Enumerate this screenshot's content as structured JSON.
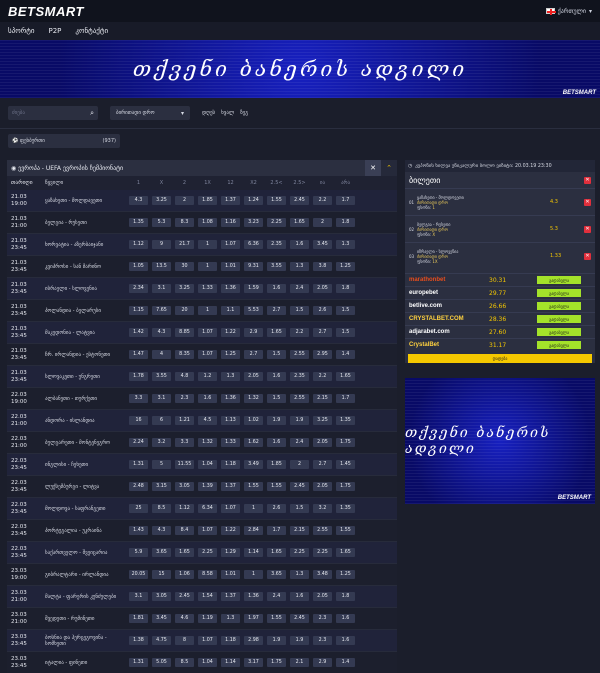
{
  "header": {
    "logo": "BETSMART",
    "language": "ქართული"
  },
  "nav": [
    "სპორტი",
    "P2P",
    "კონტაქტი"
  ],
  "banner": {
    "text": "თქვენი ბანერის ადგილი",
    "logo": "BETSMART"
  },
  "filters": {
    "search_placeholder": "ძიება",
    "period_select": "ბირითადი დრო",
    "periods": [
      "დღეს",
      "ხვალ",
      "ზეგ"
    ]
  },
  "sport_tab": {
    "label": "ფეხბურთი",
    "count": "(937)"
  },
  "league": {
    "name": "ევროპა - UEFA ევროპის ჩემპიონატი"
  },
  "columns": [
    "თარიღი",
    "წყვილი",
    "1",
    "X",
    "2",
    "1X",
    "12",
    "X2",
    "2.5<",
    "2.5>",
    "ია",
    "არა"
  ],
  "matches": [
    {
      "time": [
        "21.03",
        "19:00"
      ],
      "teams": "ყაზახეთი - მოლდავეთი",
      "odds": [
        "4.3",
        "3.25",
        "2",
        "1.85",
        "1.37",
        "1.24",
        "1.55",
        "2.45",
        "2.2",
        "1.7"
      ]
    },
    {
      "time": [
        "21.03",
        "21:00"
      ],
      "teams": "ბელგია - რუსეთი",
      "odds": [
        "1.35",
        "5.3",
        "8.3",
        "1.08",
        "1.16",
        "3.23",
        "2.25",
        "1.65",
        "2",
        "1.8"
      ]
    },
    {
      "time": [
        "21.03",
        "23:45"
      ],
      "teams": "ხორვატია - აზერბაიჯანი",
      "odds": [
        "1.12",
        "9",
        "21.7",
        "1",
        "1.07",
        "6.36",
        "2.35",
        "1.6",
        "3.45",
        "1.3"
      ]
    },
    {
      "time": [
        "21.03",
        "23:45"
      ],
      "teams": "კვიპროსი - სან მარინო",
      "odds": [
        "1.05",
        "13.5",
        "30",
        "1",
        "1.01",
        "9.31",
        "3.55",
        "1.3",
        "3.8",
        "1.25"
      ]
    },
    {
      "time": [
        "21.03",
        "23:45"
      ],
      "teams": "ისრაელი - სლოვენია",
      "odds": [
        "2.34",
        "3.1",
        "3.25",
        "1.33",
        "1.36",
        "1.59",
        "1.6",
        "2.4",
        "2.05",
        "1.8"
      ]
    },
    {
      "time": [
        "21.03",
        "23:45"
      ],
      "teams": "პოლანდია - ბელარუსი",
      "odds": [
        "1.15",
        "7.65",
        "20",
        "1",
        "1.1",
        "5.53",
        "2.7",
        "1.5",
        "2.6",
        "1.5"
      ]
    },
    {
      "time": [
        "21.03",
        "23:45"
      ],
      "teams": "მაკედონია - ლატვია",
      "odds": [
        "1.42",
        "4.3",
        "8.85",
        "1.07",
        "1.22",
        "2.9",
        "1.65",
        "2.2",
        "2.7",
        "1.5"
      ]
    },
    {
      "time": [
        "21.03",
        "23:45"
      ],
      "teams": "ჩრ. ირლანდია - ესტონეთი",
      "odds": [
        "1.47",
        "4",
        "8.35",
        "1.07",
        "1.25",
        "2.7",
        "1.5",
        "2.55",
        "2.95",
        "1.4"
      ]
    },
    {
      "time": [
        "21.03",
        "23:45"
      ],
      "teams": "სლოვაკეთი - უნგრეთი",
      "odds": [
        "1.78",
        "3.55",
        "4.8",
        "1.2",
        "1.3",
        "2.05",
        "1.6",
        "2.35",
        "2.2",
        "1.65"
      ]
    },
    {
      "time": [
        "22.03",
        "19:00"
      ],
      "teams": "ალბანეთი - თურქეთი",
      "odds": [
        "3.3",
        "3.1",
        "2.3",
        "1.6",
        "1.36",
        "1.32",
        "1.5",
        "2.55",
        "2.15",
        "1.7"
      ]
    },
    {
      "time": [
        "22.03",
        "21:00"
      ],
      "teams": "ანდორა - ისლანდია",
      "odds": [
        "16",
        "6",
        "1.21",
        "4.5",
        "1.13",
        "1.02",
        "1.9",
        "1.9",
        "3.25",
        "1.35"
      ]
    },
    {
      "time": [
        "22.03",
        "21:00"
      ],
      "teams": "ბულგარეთი - მონტენეგრო",
      "odds": [
        "2.24",
        "3.2",
        "3.3",
        "1.32",
        "1.33",
        "1.62",
        "1.6",
        "2.4",
        "2.05",
        "1.75"
      ]
    },
    {
      "time": [
        "22.03",
        "23:45"
      ],
      "teams": "ინგლისი - ჩეხეთი",
      "odds": [
        "1.31",
        "5",
        "11.55",
        "1.04",
        "1.18",
        "3.49",
        "1.85",
        "2",
        "2.7",
        "1.45"
      ]
    },
    {
      "time": [
        "22.03",
        "23:45"
      ],
      "teams": "ლუქსემბურგი - ლიტვა",
      "odds": [
        "2.48",
        "3.15",
        "3.05",
        "1.39",
        "1.37",
        "1.55",
        "1.55",
        "2.45",
        "2.05",
        "1.75"
      ]
    },
    {
      "time": [
        "22.03",
        "23:45"
      ],
      "teams": "მოლდოვა - საფრანგეთი",
      "odds": [
        "25",
        "8.5",
        "1.12",
        "6.34",
        "1.07",
        "1",
        "2.6",
        "1.5",
        "3.2",
        "1.35"
      ]
    },
    {
      "time": [
        "22.03",
        "23:45"
      ],
      "teams": "პორტუგალია - უკრაინა",
      "odds": [
        "1.43",
        "4.3",
        "8.4",
        "1.07",
        "1.22",
        "2.84",
        "1.7",
        "2.15",
        "2.55",
        "1.55"
      ]
    },
    {
      "time": [
        "22.03",
        "23:45"
      ],
      "teams": "საქართველო - შვეიცარია",
      "odds": [
        "5.9",
        "3.65",
        "1.65",
        "2.25",
        "1.29",
        "1.14",
        "1.65",
        "2.25",
        "2.25",
        "1.65"
      ]
    },
    {
      "time": [
        "23.03",
        "19:00"
      ],
      "teams": "გიბრალტარი - ირლანდია",
      "odds": [
        "20.05",
        "15",
        "1.06",
        "8.58",
        "1.01",
        "1",
        "3.65",
        "1.3",
        "3.48",
        "1.25"
      ]
    },
    {
      "time": [
        "23.03",
        "21:00"
      ],
      "teams": "მალტა - ფარერის კუნძულები",
      "odds": [
        "3.1",
        "3.05",
        "2.45",
        "1.54",
        "1.37",
        "1.36",
        "2.4",
        "1.6",
        "2.05",
        "1.8"
      ]
    },
    {
      "time": [
        "23.03",
        "21:00"
      ],
      "teams": "შვედეთი - რუმინეთი",
      "odds": [
        "1.81",
        "3.45",
        "4.6",
        "1.19",
        "1.3",
        "1.97",
        "1.55",
        "2.45",
        "2.3",
        "1.6"
      ]
    },
    {
      "time": [
        "23.03",
        "23:45"
      ],
      "teams": "ბოსნია და ჰერცეგოვინა - სომხეთი",
      "odds": [
        "1.38",
        "4.75",
        "8",
        "1.07",
        "1.18",
        "2.98",
        "1.9",
        "1.9",
        "2.3",
        "1.6"
      ]
    },
    {
      "time": [
        "23.03",
        "23:45"
      ],
      "teams": "იტალია - ფინეთი",
      "odds": [
        "1.31",
        "5.05",
        "8.5",
        "1.04",
        "1.14",
        "3.17",
        "1.75",
        "2.1",
        "2.9",
        "1.4"
      ]
    }
  ],
  "betslip": {
    "datetime": "კუპონის ხილვა უნიკალური ბოლო ვიზიტი: 20.03.19 23:30",
    "title": "ბილეთი",
    "bets": [
      {
        "num": "01",
        "teams": "ყაზახეთი - მოლდოვეთი",
        "market": "ძირითადი დრო",
        "pick_label": "ფსონი:",
        "pick": "1",
        "odd": "4.3"
      },
      {
        "num": "02",
        "teams": "ბელგია - რუსეთი",
        "market": "ძირითადი დრო",
        "pick_label": "ფსონი:",
        "pick": "X",
        "odd": "5.3"
      },
      {
        "num": "03",
        "teams": "იზრაელი - სლოვენია",
        "market": "ძირითადი დრო",
        "pick_label": "ფსონი:",
        "pick": "1X",
        "odd": "1.33"
      }
    ],
    "books": [
      {
        "name": "marathonbet",
        "value": "30.31",
        "color": "#e84d1c"
      },
      {
        "name": "europebet",
        "value": "29.77",
        "color": "#ffffff"
      },
      {
        "name": "betlive.com",
        "value": "26.66",
        "color": "#ffffff"
      },
      {
        "name": "CRYSTALBET.COM",
        "value": "28.36",
        "color": "#ffd23f"
      },
      {
        "name": "adjarabet.com",
        "value": "27.60",
        "color": "#ffffff"
      },
      {
        "name": "CrystalBet",
        "value": "31.17",
        "color": "#ffd23f"
      }
    ],
    "go_label": "გადასვლა",
    "play_label": "დადება"
  },
  "side_banner": {
    "text": "თქვენი ბანერის ადგილი",
    "logo": "BETSMART"
  }
}
